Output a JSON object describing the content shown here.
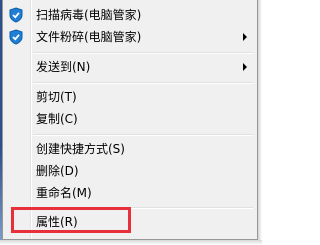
{
  "menu": {
    "items": [
      {
        "label": "扫描病毒(电脑管家)",
        "icon": "shield-icon",
        "submenu": false
      },
      {
        "label": "文件粉碎(电脑管家)",
        "icon": "shield-icon",
        "submenu": true
      },
      {
        "label": "发送到(N)",
        "submenu": true
      },
      {
        "label": "剪切(T)",
        "submenu": false
      },
      {
        "label": "复制(C)",
        "submenu": false
      },
      {
        "label": "创建快捷方式(S)",
        "submenu": false
      },
      {
        "label": "删除(D)",
        "submenu": false
      },
      {
        "label": "重命名(M)",
        "submenu": false
      },
      {
        "label": "属性(R)",
        "submenu": false
      }
    ]
  },
  "colors": {
    "highlight_box": "#e8303b",
    "shield": "#1e7fd4"
  }
}
